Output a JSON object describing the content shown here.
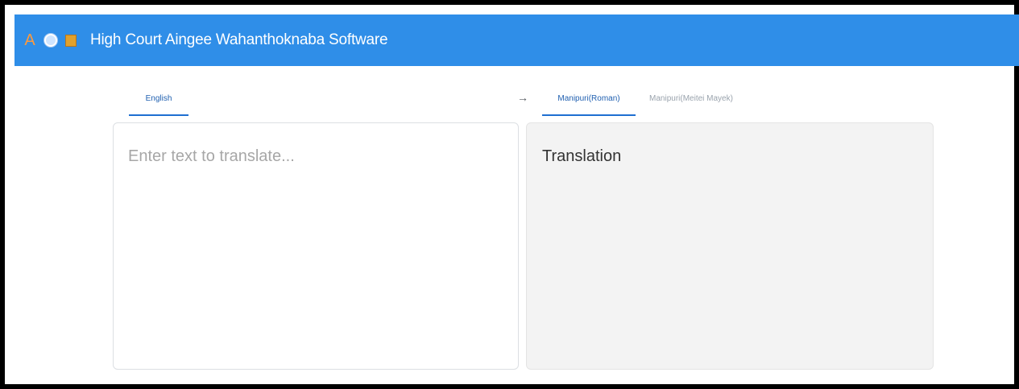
{
  "app": {
    "logo_letter": "A",
    "title": "High Court Aingee Wahanthoknaba Software"
  },
  "source": {
    "tabs": [
      {
        "label": "English",
        "active": true
      }
    ],
    "input_value": "",
    "placeholder": "Enter text to translate..."
  },
  "swap_arrow": "→",
  "target": {
    "tabs": [
      {
        "label": "Manipuri(Roman)",
        "active": true
      },
      {
        "label": "Manipuri(Meitei Mayek)",
        "active": false
      }
    ],
    "output": "Translation"
  },
  "colors": {
    "appbar": "#2f8ee8",
    "accent": "#1f6fd1",
    "logo_a": "#ff9a3c",
    "logo_book": "#e1a12d",
    "output_panel_bg": "#f3f3f3"
  },
  "icons": {
    "logo_a": "letter-a-logo",
    "logo_circle": "circle-emblem-icon",
    "logo_book": "book-icon",
    "swap": "arrow-right-icon"
  }
}
